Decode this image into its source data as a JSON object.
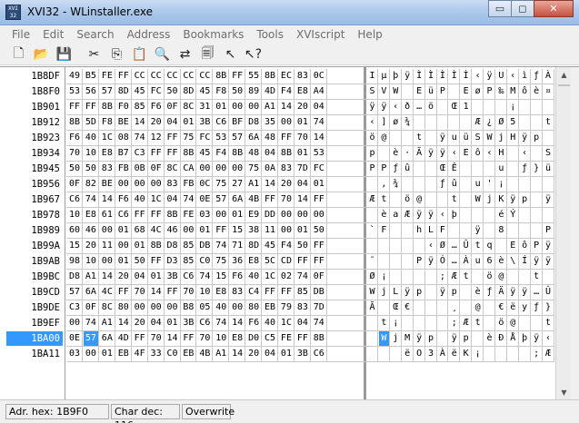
{
  "window": {
    "icon_text": "XVI 32",
    "title": "XVI32 - WLinstaller.exe",
    "minimize_glyph": "▭",
    "maximize_glyph": "◻",
    "close_glyph": "✕"
  },
  "menu": [
    "File",
    "Edit",
    "Search",
    "Address",
    "Bookmarks",
    "Tools",
    "XVIscript",
    "Help"
  ],
  "toolbar": [
    {
      "name": "new-file-icon",
      "glyph": "🗋"
    },
    {
      "name": "open-folder-icon",
      "glyph": "📂"
    },
    {
      "name": "save-icon",
      "glyph": "💾"
    },
    {
      "name": "sep"
    },
    {
      "name": "cut-icon",
      "glyph": "✂"
    },
    {
      "name": "copy-icon",
      "glyph": "⎘"
    },
    {
      "name": "paste-icon",
      "glyph": "📋"
    },
    {
      "name": "find-icon",
      "glyph": "🔍"
    },
    {
      "name": "replace-icon",
      "glyph": "⇄"
    },
    {
      "name": "properties-icon",
      "glyph": "🗐"
    },
    {
      "name": "goto-icon",
      "glyph": "↖"
    },
    {
      "name": "help-icon",
      "glyph": "↖?"
    }
  ],
  "editor": {
    "selected_row": 17,
    "selected_col": 1,
    "rows": [
      {
        "addr": "1B8DF",
        "hex": [
          "49",
          "B5",
          "FE",
          "FF",
          "CC",
          "CC",
          "CC",
          "CC",
          "CC",
          "8B",
          "FF",
          "55",
          "8B",
          "EC",
          "83",
          "0C"
        ],
        "ascii": [
          "I",
          "µ",
          "þ",
          "ÿ",
          "Ì",
          "Ì",
          "Ì",
          "Ì",
          "Ì",
          "‹",
          "ÿ",
          "U",
          "‹",
          "ì",
          "ƒ",
          "À"
        ]
      },
      {
        "addr": "1B8F0",
        "hex": [
          "53",
          "56",
          "57",
          "8D",
          "45",
          "FC",
          "50",
          "8D",
          "45",
          "F8",
          "50",
          "89",
          "4D",
          "F4",
          "E8",
          "A4"
        ],
        "ascii": [
          "S",
          "V",
          "W",
          "",
          "E",
          "ü",
          "P",
          "",
          "E",
          "ø",
          "P",
          "‰",
          "M",
          "ô",
          "è",
          "¤"
        ]
      },
      {
        "addr": "1B901",
        "hex": [
          "FF",
          "FF",
          "8B",
          "F0",
          "85",
          "F6",
          "0F",
          "8C",
          "31",
          "01",
          "00",
          "00",
          "A1",
          "14",
          "20",
          "04"
        ],
        "ascii": [
          "ÿ",
          "ÿ",
          "‹",
          "ð",
          "…",
          "ö",
          "",
          "Œ",
          "1",
          "",
          "",
          "",
          "¡",
          "",
          "",
          ""
        ]
      },
      {
        "addr": "1B912",
        "hex": [
          "8B",
          "5D",
          "F8",
          "BE",
          "14",
          "20",
          "04",
          "01",
          "3B",
          "C6",
          "BF",
          "D8",
          "35",
          "00",
          "01",
          "74"
        ],
        "ascii": [
          "‹",
          "]",
          "ø",
          "¾",
          "",
          "",
          "",
          "",
          "",
          "Æ",
          "¿",
          "Ø",
          "5",
          "",
          "",
          "t"
        ]
      },
      {
        "addr": "1B923",
        "hex": [
          "F6",
          "40",
          "1C",
          "08",
          "74",
          "12",
          "FF",
          "75",
          "FC",
          "53",
          "57",
          "6A",
          "48",
          "FF",
          "70",
          "14"
        ],
        "ascii": [
          "ö",
          "@",
          "",
          "",
          "t",
          "",
          "ÿ",
          "u",
          "ü",
          "S",
          "W",
          "j",
          "H",
          "ÿ",
          "p",
          ""
        ]
      },
      {
        "addr": "1B934",
        "hex": [
          "70",
          "10",
          "E8",
          "B7",
          "C3",
          "FF",
          "FF",
          "8B",
          "45",
          "F4",
          "8B",
          "48",
          "04",
          "8B",
          "01",
          "53"
        ],
        "ascii": [
          "p",
          "",
          "è",
          "·",
          "Ã",
          "ÿ",
          "ÿ",
          "‹",
          "E",
          "ô",
          "‹",
          "H",
          "",
          "‹",
          "",
          "S"
        ]
      },
      {
        "addr": "1B945",
        "hex": [
          "50",
          "50",
          "83",
          "FB",
          "0B",
          "0F",
          "8C",
          "CA",
          "00",
          "00",
          "00",
          "75",
          "0A",
          "83",
          "7D",
          "FC"
        ],
        "ascii": [
          "P",
          "P",
          "ƒ",
          "û",
          "",
          "",
          "Œ",
          "Ê",
          "",
          "",
          "",
          "u",
          "",
          "ƒ",
          "}",
          "ü"
        ]
      },
      {
        "addr": "1B956",
        "hex": [
          "0F",
          "82",
          "BE",
          "00",
          "00",
          "00",
          "83",
          "FB",
          "0C",
          "75",
          "27",
          "A1",
          "14",
          "20",
          "04",
          "01"
        ],
        "ascii": [
          "",
          "‚",
          "¾",
          "",
          "",
          "",
          "ƒ",
          "û",
          "",
          "u",
          "'",
          "¡",
          "",
          "",
          "",
          ""
        ]
      },
      {
        "addr": "1B967",
        "hex": [
          "C6",
          "74",
          "14",
          "F6",
          "40",
          "1C",
          "04",
          "74",
          "0E",
          "57",
          "6A",
          "4B",
          "FF",
          "70",
          "14",
          "FF"
        ],
        "ascii": [
          "Æ",
          "t",
          "",
          "ö",
          "@",
          "",
          "",
          "t",
          "",
          "W",
          "j",
          "K",
          "ÿ",
          "p",
          "",
          "ÿ"
        ]
      },
      {
        "addr": "1B978",
        "hex": [
          "10",
          "E8",
          "61",
          "C6",
          "FF",
          "FF",
          "8B",
          "FE",
          "03",
          "00",
          "01",
          "E9",
          "DD",
          "00",
          "00",
          "00"
        ],
        "ascii": [
          "",
          "è",
          "a",
          "Æ",
          "ÿ",
          "ÿ",
          "‹",
          "þ",
          "",
          "",
          "",
          "é",
          "Ý",
          "",
          "",
          ""
        ]
      },
      {
        "addr": "1B989",
        "hex": [
          "60",
          "46",
          "00",
          "01",
          "68",
          "4C",
          "46",
          "00",
          "01",
          "FF",
          "15",
          "38",
          "11",
          "00",
          "01",
          "50"
        ],
        "ascii": [
          "`",
          "F",
          "",
          "",
          "h",
          "L",
          "F",
          "",
          "",
          "ÿ",
          "",
          "8",
          "",
          "",
          "",
          "P"
        ]
      },
      {
        "addr": "1B99A",
        "hex": [
          "15",
          "20",
          "11",
          "00",
          "01",
          "8B",
          "D8",
          "85",
          "DB",
          "74",
          "71",
          "8D",
          "45",
          "F4",
          "50",
          "FF"
        ],
        "ascii": [
          "",
          "",
          "",
          "",
          "",
          "‹",
          "Ø",
          "…",
          "Û",
          "t",
          "q",
          "",
          "E",
          "ô",
          "P",
          "ÿ"
        ]
      },
      {
        "addr": "1B9AB",
        "hex": [
          "98",
          "10",
          "00",
          "01",
          "50",
          "FF",
          "D3",
          "85",
          "C0",
          "75",
          "36",
          "E8",
          "5C",
          "CD",
          "FF",
          "FF"
        ],
        "ascii": [
          "˜",
          "",
          "",
          "",
          "P",
          "ÿ",
          "Ó",
          "…",
          "À",
          "u",
          "6",
          "è",
          "\\",
          "Í",
          "ÿ",
          "ÿ"
        ]
      },
      {
        "addr": "1B9BC",
        "hex": [
          "D8",
          "A1",
          "14",
          "20",
          "04",
          "01",
          "3B",
          "C6",
          "74",
          "15",
          "F6",
          "40",
          "1C",
          "02",
          "74",
          "0F"
        ],
        "ascii": [
          "Ø",
          "¡",
          "",
          "",
          "",
          "",
          ";",
          "Æ",
          "t",
          "",
          "ö",
          "@",
          "",
          "",
          "t",
          ""
        ]
      },
      {
        "addr": "1B9CD",
        "hex": [
          "57",
          "6A",
          "4C",
          "FF",
          "70",
          "14",
          "FF",
          "70",
          "10",
          "E8",
          "83",
          "C4",
          "FF",
          "FF",
          "85",
          "DB"
        ],
        "ascii": [
          "W",
          "j",
          "L",
          "ÿ",
          "p",
          "",
          "ÿ",
          "p",
          "",
          "è",
          "ƒ",
          "Ä",
          "ÿ",
          "ÿ",
          "…",
          "Û"
        ]
      },
      {
        "addr": "1B9DE",
        "hex": [
          "C3",
          "0F",
          "8C",
          "80",
          "00",
          "00",
          "00",
          "B8",
          "05",
          "40",
          "00",
          "80",
          "EB",
          "79",
          "83",
          "7D"
        ],
        "ascii": [
          "Ã",
          "",
          "Œ",
          "€",
          "",
          "",
          "",
          "¸",
          "",
          "@",
          "",
          "€",
          "ë",
          "y",
          "ƒ",
          "}"
        ]
      },
      {
        "addr": "1B9EF",
        "hex": [
          "00",
          "74",
          "A1",
          "14",
          "20",
          "04",
          "01",
          "3B",
          "C6",
          "74",
          "14",
          "F6",
          "40",
          "1C",
          "04",
          "74"
        ],
        "ascii": [
          "",
          "t",
          "¡",
          "",
          "",
          "",
          "",
          ";",
          "Æ",
          "t",
          "",
          "ö",
          "@",
          "",
          "",
          "t"
        ]
      },
      {
        "addr": "1BA00",
        "hex": [
          "0E",
          "57",
          "6A",
          "4D",
          "FF",
          "70",
          "14",
          "FF",
          "70",
          "10",
          "E8",
          "D0",
          "C5",
          "FE",
          "FF",
          "8B"
        ],
        "ascii": [
          "",
          "W",
          "j",
          "M",
          "ÿ",
          "p",
          "",
          "ÿ",
          "p",
          "",
          "è",
          "Ð",
          "Å",
          "þ",
          "ÿ",
          "‹"
        ]
      },
      {
        "addr": "1BA11",
        "hex": [
          "03",
          "00",
          "01",
          "EB",
          "4F",
          "33",
          "C0",
          "EB",
          "4B",
          "A1",
          "14",
          "20",
          "04",
          "01",
          "3B",
          "C6"
        ],
        "ascii": [
          "",
          "",
          "",
          "ë",
          "O",
          "3",
          "À",
          "ë",
          "K",
          "¡",
          "",
          "",
          "",
          "",
          ";",
          "Æ"
        ]
      }
    ]
  },
  "scrollbar": {
    "up_glyph": "▲",
    "down_glyph": "▼"
  },
  "status": {
    "addr_hex": "Adr. hex: 1B9F0",
    "char_dec": "Char dec: 116",
    "mode": "Overwrite"
  }
}
